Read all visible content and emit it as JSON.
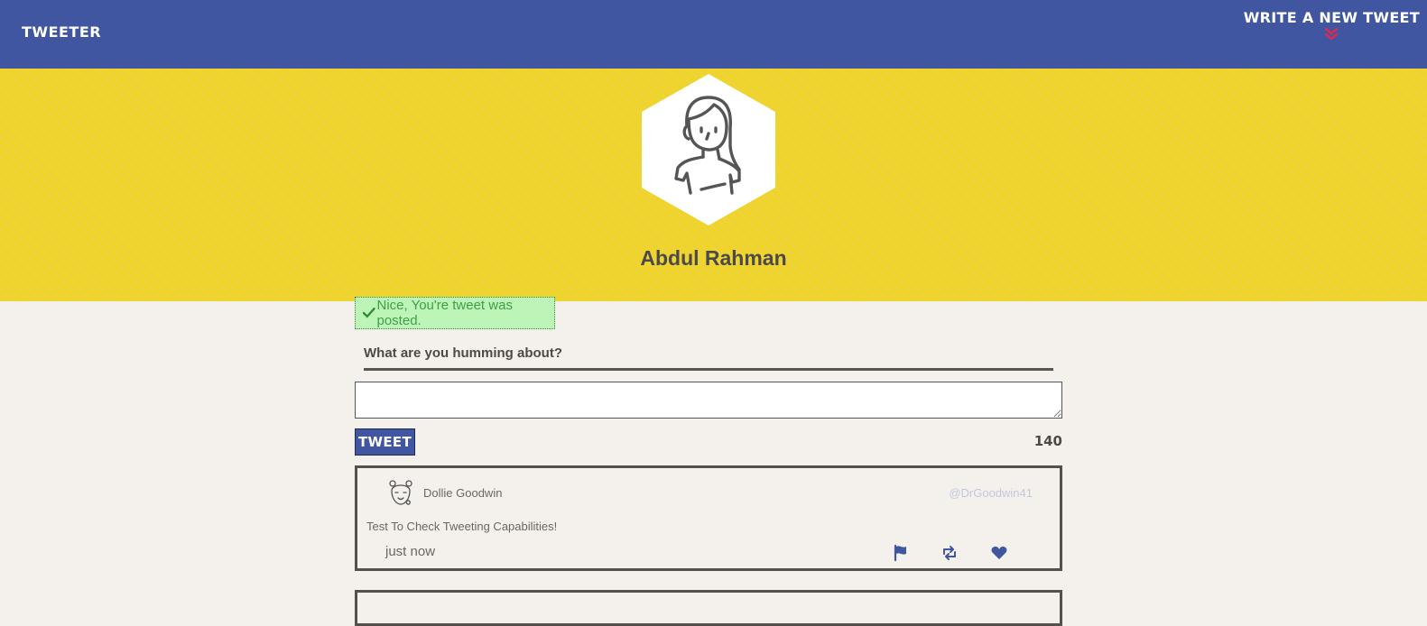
{
  "nav": {
    "brand": "Tweeter",
    "compose_toggle_label": "Write a new tweet",
    "compose_toggle_icon": "double-chevron-down-icon",
    "accent_color": "#e8254b"
  },
  "profile": {
    "name": "Abdul Rahman",
    "avatar_icon": "user-avatar-icon"
  },
  "flash": {
    "icon": "checkmark-icon",
    "message": "Nice, You're tweet was posted."
  },
  "composer": {
    "prompt": "What are you humming about?",
    "value": "",
    "submit_label": "Tweet",
    "char_counter": "140"
  },
  "tweets": [
    {
      "name": "Dollie Goodwin",
      "handle": "@DrGoodwin41",
      "body": "Test To Check Tweeting Capabilities!",
      "time": "just now",
      "actions": [
        "flag-icon",
        "retweet-icon",
        "heart-icon"
      ]
    }
  ],
  "colors": {
    "nav_bg": "#4056a1",
    "hero_bg": "#f0d433",
    "page_bg": "#f4f1ec",
    "success_bg": "#bdf5b8"
  }
}
